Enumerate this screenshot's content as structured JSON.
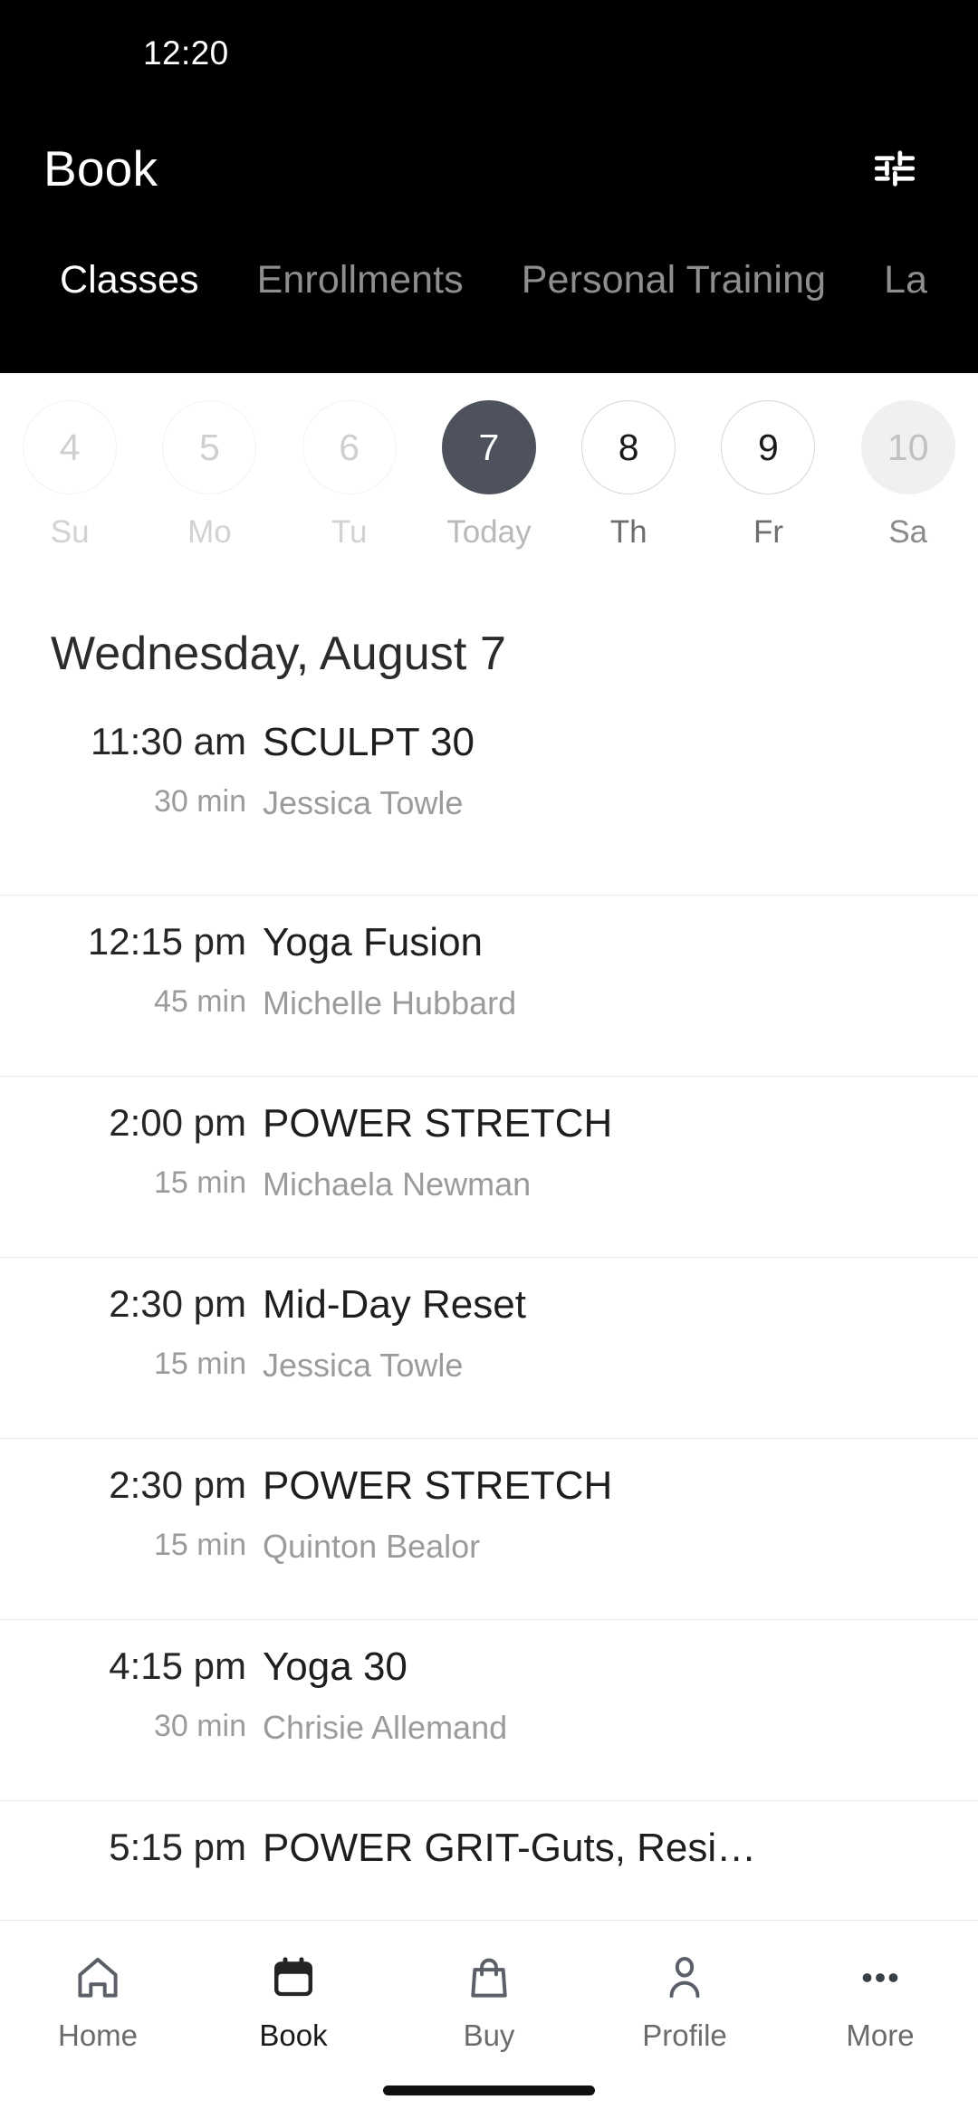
{
  "status_bar": {
    "time": "12:20"
  },
  "app_bar": {
    "title": "Book",
    "filter_icon": "tune-sliders-icon"
  },
  "tabs": [
    {
      "label": "Classes",
      "active": true
    },
    {
      "label": "Enrollments",
      "active": false
    },
    {
      "label": "Personal Training",
      "active": false
    },
    {
      "label": "La",
      "active": false
    }
  ],
  "day_strip": [
    {
      "day": "4",
      "weekday": "Su",
      "state": "past"
    },
    {
      "day": "5",
      "weekday": "Mo",
      "state": "past"
    },
    {
      "day": "6",
      "weekday": "Tu",
      "state": "past"
    },
    {
      "day": "7",
      "weekday": "Today",
      "state": "selected"
    },
    {
      "day": "8",
      "weekday": "Th",
      "state": "future"
    },
    {
      "day": "9",
      "weekday": "Fr",
      "state": "future"
    },
    {
      "day": "10",
      "weekday": "Sa",
      "state": "filled"
    }
  ],
  "date_heading": "Wednesday, August 7",
  "classes": [
    {
      "time": "11:30 am",
      "duration": "30 min",
      "title": "SCULPT 30",
      "instructor": "Jessica Towle"
    },
    {
      "time": "12:15 pm",
      "duration": "45 min",
      "title": "Yoga Fusion",
      "instructor": "Michelle Hubbard"
    },
    {
      "time": "2:00 pm",
      "duration": "15 min",
      "title": "POWER STRETCH",
      "instructor": "Michaela Newman"
    },
    {
      "time": "2:30 pm",
      "duration": "15 min",
      "title": "Mid-Day Reset",
      "instructor": "Jessica Towle"
    },
    {
      "time": "2:30 pm",
      "duration": "15 min",
      "title": "POWER STRETCH",
      "instructor": "Quinton Bealor"
    },
    {
      "time": "4:15 pm",
      "duration": "30 min",
      "title": "Yoga 30",
      "instructor": "Chrisie Allemand"
    },
    {
      "time": "5:15 pm",
      "duration": "",
      "title": "POWER GRIT-Guts, Resi…",
      "instructor": ""
    }
  ],
  "bottom_nav": [
    {
      "label": "Home",
      "icon": "home-icon",
      "active": false
    },
    {
      "label": "Book",
      "icon": "calendar-icon",
      "active": true
    },
    {
      "label": "Buy",
      "icon": "shopping-bag-icon",
      "active": false
    },
    {
      "label": "Profile",
      "icon": "person-icon",
      "active": false
    },
    {
      "label": "More",
      "icon": "more-dots-icon",
      "active": false
    }
  ],
  "colors": {
    "header_background": "#000000",
    "selected_day": "#4e525c",
    "active_tab_text": "#ffffff",
    "inactive_tab_text": "#8e8e8e",
    "primary_text": "#1e1e1e",
    "secondary_text": "#9b9b9b"
  }
}
